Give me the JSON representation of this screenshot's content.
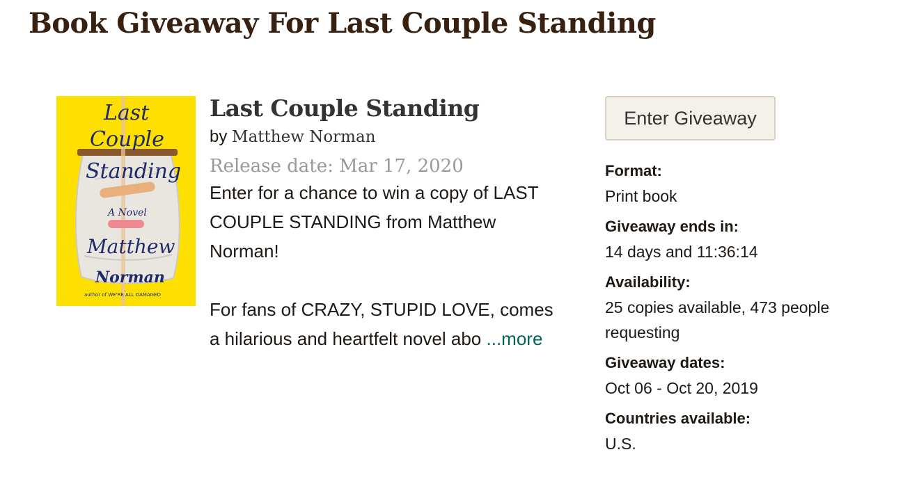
{
  "page": {
    "title": "Book Giveaway For Last Couple Standing"
  },
  "book": {
    "cover_text": {
      "line1": "Last",
      "line2": "Couple",
      "line3": "Standing",
      "subtitle": "A Novel",
      "author1": "Matthew",
      "author2": "Norman",
      "tagline": "author of WE'RE ALL DAMAGED"
    },
    "title": "Last Couple Standing",
    "by_prefix": "by",
    "author": "Matthew Norman",
    "release_date": "Release date: Mar 17, 2020",
    "description_p1": "Enter for a chance to win a copy of LAST COUPLE STANDING from Matthew Norman!",
    "description_p2": "For fans of CRAZY, STUPID LOVE, comes a hilarious and heartfelt novel abo",
    "more_link": "...more"
  },
  "giveaway": {
    "enter_button": "Enter Giveaway",
    "details": [
      {
        "label": "Format:",
        "value": "Print book"
      },
      {
        "label": "Giveaway ends in:",
        "value": "14 days and 11:36:14"
      },
      {
        "label": "Availability:",
        "value": "25 copies available, 473 people requesting"
      },
      {
        "label": "Giveaway dates:",
        "value": "Oct 06 - Oct 20, 2019"
      },
      {
        "label": "Countries available:",
        "value": "U.S."
      }
    ]
  },
  "colors": {
    "heading": "#382110",
    "link": "#00635d",
    "muted": "#999999",
    "cover_yellow": "#fde000",
    "button_bg": "#f4f1ea"
  }
}
